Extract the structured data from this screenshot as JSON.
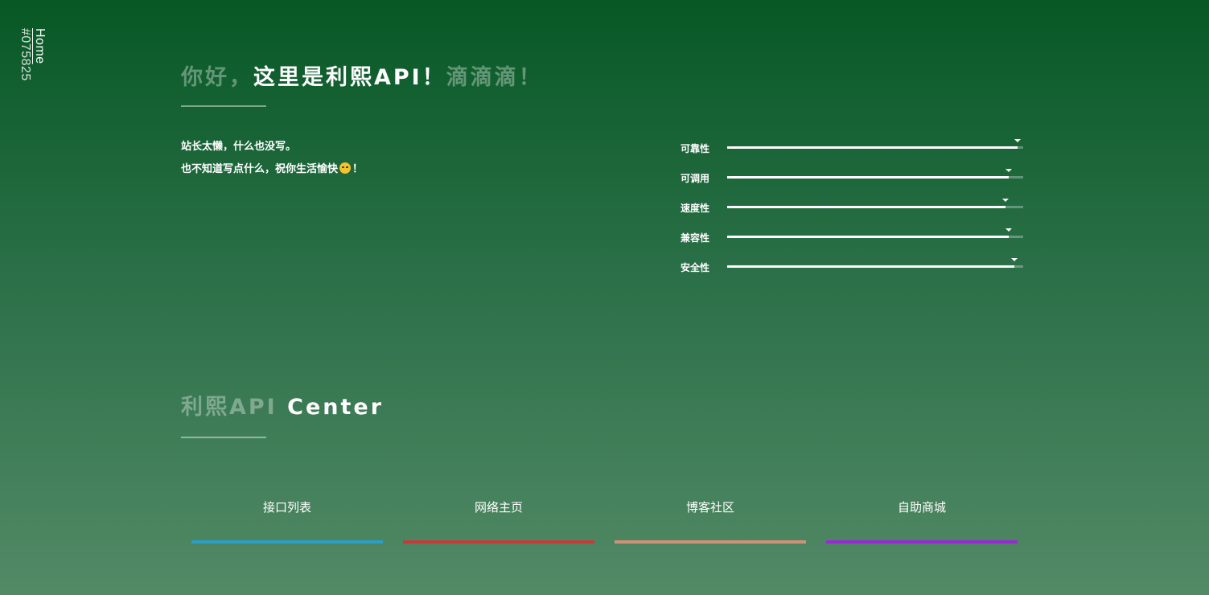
{
  "side_nav": {
    "home_label": "Home",
    "color_code": "#075825"
  },
  "hero": {
    "title_prefix": "你好，",
    "title_main": "这里是利熙API！",
    "title_suffix": "滴滴滴！",
    "line1": "站长太懒，什么也没写。",
    "line2_text": "也不知道写点什么，祝你生活愉快",
    "line2_emoji_icon": "smiling-face-icon",
    "line2_end": "！"
  },
  "skills": [
    {
      "label": "可靠性",
      "value": 98
    },
    {
      "label": "可调用",
      "value": 95
    },
    {
      "label": "速度性",
      "value": 94
    },
    {
      "label": "兼容性",
      "value": 95
    },
    {
      "label": "安全性",
      "value": 97
    }
  ],
  "center": {
    "title_muted": "利熙API",
    "title_bright": "Center"
  },
  "nav_items": [
    {
      "label": "接口列表",
      "color": "#2a9fc7"
    },
    {
      "label": "网络主页",
      "color": "#c8393a"
    },
    {
      "label": "博客社区",
      "color": "#d0907a"
    },
    {
      "label": "自助商城",
      "color": "#9b27d9"
    }
  ],
  "colors": {
    "background_top": "#075825",
    "background_bottom": "#528a66"
  }
}
